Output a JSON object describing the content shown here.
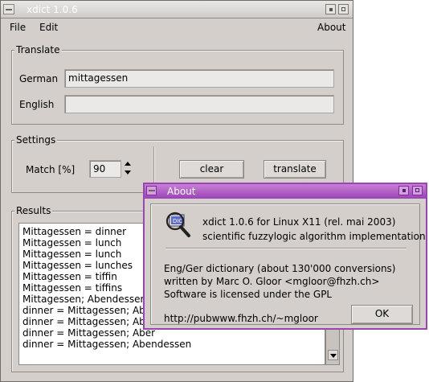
{
  "window": {
    "title": "xdict 1.0.6"
  },
  "menubar": {
    "file": "File",
    "edit": "Edit",
    "about": "About"
  },
  "translate": {
    "title": "Translate",
    "german_label": "German",
    "german_value": "mittagessen",
    "english_label": "English",
    "english_value": ""
  },
  "settings": {
    "title": "Settings",
    "match_label": "Match [%]",
    "match_value": "90",
    "clear_label": "clear",
    "translate_label": "translate"
  },
  "results": {
    "title": "Results",
    "lines": [
      "Mittagessen = dinner",
      "Mittagessen = lunch",
      "Mittagessen = lunch",
      "Mittagessen = lunches",
      "Mittagessen = tiffin",
      "Mittagessen = tiffins",
      "Mittagessen; Abendessen = ",
      "dinner = Mittagessen; Aben",
      "dinner = Mittagessen; Aber",
      "dinner = Mittagessen; Aber",
      "dinner = Mittagessen; Abendessen"
    ]
  },
  "about_dialog": {
    "title": "About",
    "line1": "xdict 1.0.6 for Linux X11 (rel. mai 2003)",
    "line2": "scientific fuzzylogic algorithm implementation",
    "line3": "Eng/Ger dictionary (about 130'000 conversions)",
    "line4": "written by Marc O. Gloor <mgloor@fhzh.ch>",
    "line5": "Software is licensed under the GPL",
    "url": "http://pubwww.fhzh.ch/~mgloor",
    "ok_label": "OK",
    "icon": "magnifier-dictionary-icon",
    "accent_color": "#9b44b2"
  }
}
